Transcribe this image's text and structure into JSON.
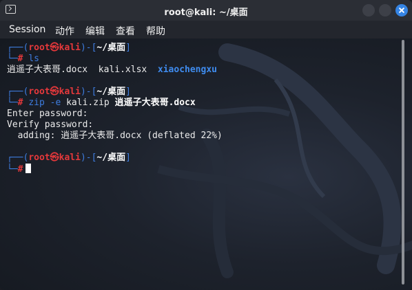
{
  "window": {
    "title": "root@kali: ~/桌面"
  },
  "menu": [
    "Session",
    "动作",
    "编辑",
    "查看",
    "帮助"
  ],
  "prompt": {
    "open": "┌──(",
    "user": "root㉿kali",
    "mid": ")-[",
    "path": "~/桌面",
    "close": "]",
    "second": "└─",
    "hash": "#"
  },
  "commands": {
    "ls": "ls",
    "zip_prog": "zip",
    "zip_flag": "-e",
    "zip_archive": "kali.zip",
    "zip_file": "逍遥子大表哥.docx"
  },
  "output": {
    "ls_files": "逍遥子大表哥.docx  kali.xlsx  ",
    "ls_dir": "xiaochengxu",
    "enter_pw": "Enter password:",
    "verify_pw": "Verify password:",
    "adding": "  adding: 逍遥子大表哥.docx (deflated 22%)"
  },
  "colors": {
    "accent": "#3584e4",
    "prompt_blue": "#3e7de0",
    "prompt_red": "#e5383b"
  }
}
